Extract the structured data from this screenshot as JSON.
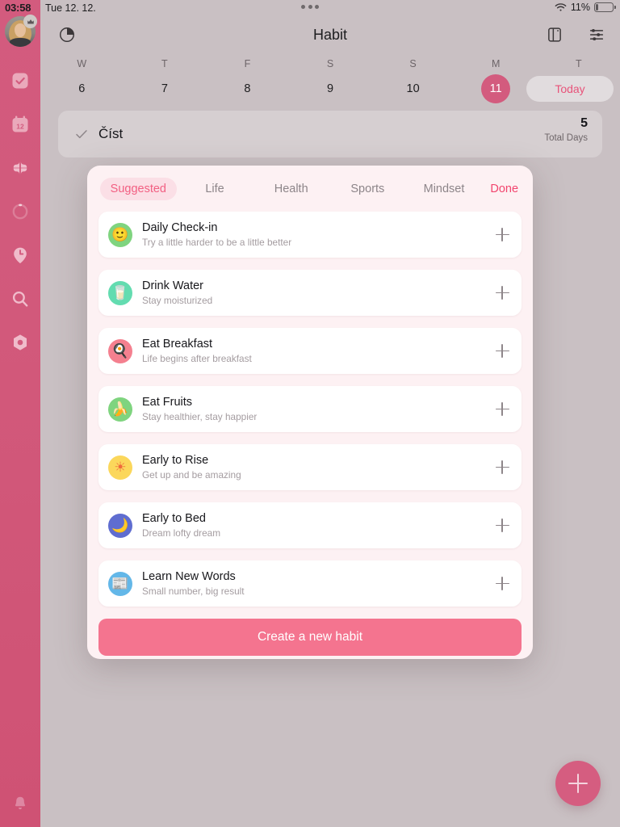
{
  "status_bar": {
    "time": "03:58",
    "date": "Tue 12. 12.",
    "battery_percent": "11%",
    "wifi_icon": "wifi-icon",
    "battery_icon": "battery-icon",
    "handle_icon": "multitask-dots-icon"
  },
  "sidebar": {
    "avatar_name": "user-avatar",
    "crown_badge": "crown-icon",
    "items": [
      {
        "icon": "check-square-icon",
        "name": "sidebar-item-tasks"
      },
      {
        "icon": "calendar-12-icon",
        "name": "sidebar-item-calendar"
      },
      {
        "icon": "grid-four-icon",
        "name": "sidebar-item-habits"
      },
      {
        "icon": "progress-ring-icon",
        "name": "sidebar-item-progress"
      },
      {
        "icon": "clock-pin-icon",
        "name": "sidebar-item-timer"
      },
      {
        "icon": "search-icon",
        "name": "sidebar-item-search"
      },
      {
        "icon": "hexagon-settings-icon",
        "name": "sidebar-item-settings"
      }
    ],
    "bell_icon": "bell-icon"
  },
  "navbar": {
    "title": "Habit",
    "left_icon": "pie-chart-icon",
    "right_icons": [
      {
        "icon": "sidebar-toggle-icon",
        "name": "panel-toggle-button"
      },
      {
        "icon": "sliders-icon",
        "name": "filter-settings-button"
      }
    ]
  },
  "week_strip": {
    "weekday_labels": [
      "W",
      "T",
      "F",
      "S",
      "S",
      "M",
      "T"
    ],
    "day_numbers": [
      "6",
      "7",
      "8",
      "9",
      "10",
      "11",
      ""
    ],
    "selected_index": 5,
    "today_label": "Today",
    "accent": "#d35b7e"
  },
  "habit_row": {
    "check_icon": "check-icon",
    "name": "Číst",
    "count": "5",
    "count_label": "Total Days"
  },
  "modal": {
    "tabs": [
      {
        "label": "Suggested",
        "active": true
      },
      {
        "label": "Life",
        "active": false
      },
      {
        "label": "Health",
        "active": false
      },
      {
        "label": "Sports",
        "active": false
      },
      {
        "label": "Mindset",
        "active": false
      }
    ],
    "done_label": "Done",
    "items": [
      {
        "title": "Daily Check-in",
        "subtitle": "Try a little harder to be a little better",
        "emoji": "🙂",
        "icon_name": "smiley-face-icon",
        "bg": "#7fd47f"
      },
      {
        "title": "Drink Water",
        "subtitle": "Stay moisturized",
        "emoji": "🥛",
        "icon_name": "water-glass-icon",
        "bg": "#63dcb0"
      },
      {
        "title": "Eat Breakfast",
        "subtitle": "Life begins after breakfast",
        "emoji": "🍳",
        "icon_name": "breakfast-icon",
        "bg": "#f4808f"
      },
      {
        "title": "Eat Fruits",
        "subtitle": "Stay healthier, stay happier",
        "emoji": "🍌",
        "icon_name": "banana-icon",
        "bg": "#7fd47f"
      },
      {
        "title": "Early to Rise",
        "subtitle": "Get up and be amazing",
        "emoji": "☀",
        "icon_name": "sun-icon",
        "bg": "#fbd75b"
      },
      {
        "title": "Early to Bed",
        "subtitle": "Dream lofty dream",
        "emoji": "🌙",
        "icon_name": "moon-sleep-icon",
        "bg": "#5f6dd0"
      },
      {
        "title": "Learn New Words",
        "subtitle": "Small number, big result",
        "emoji": "📰",
        "icon_name": "newspaper-icon",
        "bg": "#63b7e8"
      }
    ],
    "cta_label": "Create a new habit",
    "cta_color": "#f4748f"
  },
  "fab": {
    "icon": "plus-icon",
    "color": "#d55d80"
  }
}
